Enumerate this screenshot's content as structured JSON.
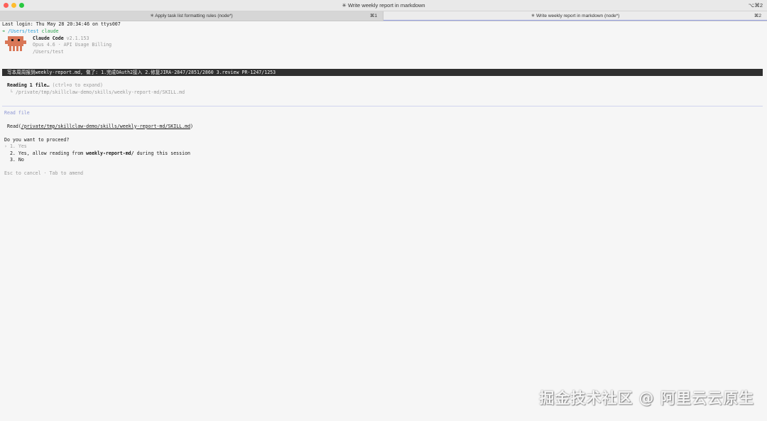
{
  "window": {
    "title": "✳ Write weekly report in markdown",
    "shortcut": "⌥⌘2"
  },
  "tabs": [
    {
      "label": "✳ Apply task list formatting rules (node*)",
      "shortcut": "⌘1"
    },
    {
      "label": "✳ Write weekly report in markdown (node*)",
      "shortcut": "⌘2"
    }
  ],
  "terminal": {
    "last_login": "Last login: Thu May 28 20:34:46 on ttys007",
    "prompt_arrow": "➜",
    "prompt_path": "/Users/test",
    "prompt_cmd": "claude",
    "app_name": "Claude Code",
    "app_version": "v2.1.153",
    "model_line": "Opus 4.6 · API Usage Billing",
    "cwd": "/Users/test",
    "user_message": " 写本周周报到weekly-report.md, 做了: 1.完成OAuth2接入 2.修复JIRA-2847/2851/2860 3.review PR-1247/1253",
    "reading_label": "Reading 1 file…",
    "reading_hint": "(ctrl+o to expand)",
    "reading_path": "└ /private/tmp/skillclaw-demo/skills/weekly-report-md/SKILL.md",
    "section_title": "Read file",
    "read_call_prefix": "Read(",
    "read_call_path": "/private/tmp/skillclaw-demo/skills/weekly-report-md/SKILL.md",
    "read_call_suffix": ")",
    "question": "Do you want to proceed?",
    "options": [
      {
        "label": "› 1. Yes"
      },
      {
        "prefix": "  2. Yes, allow reading from ",
        "bold": "weekly-report-md/",
        "suffix": " during this session"
      },
      {
        "label": "  3. No"
      }
    ],
    "footer_hint": "Esc to cancel · Tab to amend"
  },
  "watermark": "掘金技术社区 @ 阿里云云原生"
}
